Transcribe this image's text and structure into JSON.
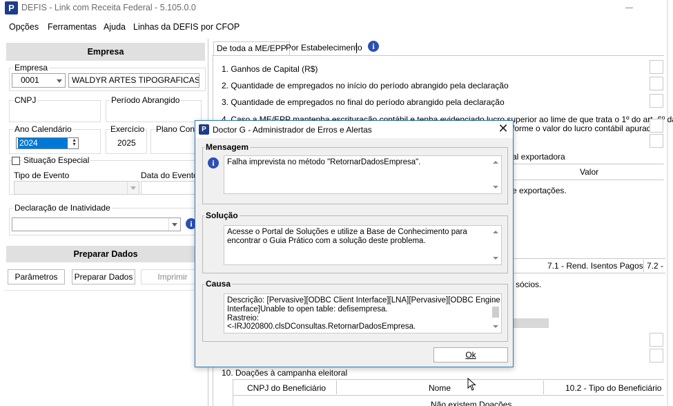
{
  "window": {
    "title": "DEFIS - Link com Receita Federal - 5.105.0.0",
    "icon_letter": "P"
  },
  "menu": [
    "Opções",
    "Ferramentas",
    "Ajuda",
    "Linhas da DEFIS por CFOP"
  ],
  "left": {
    "empresa_header": "Empresa",
    "empresa_label": "Empresa",
    "empresa_code": "0001",
    "empresa_name": "WALDYR ARTES TIPOGRAFICAS LTDA",
    "cnpj_label": "CNPJ",
    "periodo_label": "Período Abrangido",
    "ano_label": "Ano Calendário",
    "ano_value": "2024",
    "exercicio_label": "Exercício",
    "exercicio_value": "2025",
    "plano_label": "Plano Conta",
    "situacao_label": "Situação Especial",
    "tipo_evento_label": "Tipo de Evento",
    "data_evento_label": "Data do Evento",
    "declaracao_label": "Declaração de Inatividade",
    "preparar_header": "Preparar Dados",
    "btn_parametros": "Parâmetros",
    "btn_preparar": "Preparar Dados",
    "btn_imprimir": "Imprimir"
  },
  "right": {
    "tab1": "De toda a ME/EPP",
    "tab2": "Por Estabelecimento",
    "rows": [
      "1. Ganhos de Capital (R$)",
      "2. Quantidade de empregados no início do período abrangido pela declaração",
      "3. Quantidade de empregados no final do período abrangido pela declaração",
      "4. Caso a ME/EPP mantenha escrituração contábil e tenha evidenciado lucro superior ao lime de que trata o 1º do art. 6º da"
    ],
    "row4_cont": "forme o valor do lucro contábil apurado",
    "exportadora": "al exportadora",
    "valor_header": "Valor",
    "exportacoes": "e exportações.",
    "tab_isentos": "7.1 - Rend. Isentos Pagos",
    "tab_72": "7.2 -",
    "socios": "sócios.",
    "doacoes": "10. Doações à campanha eleitoral",
    "col_cnpj": "CNPJ do Beneficiário",
    "col_nome": "Nome",
    "col_tipo": "10.2 - Tipo do Beneficiário",
    "cut_text": "Não existem Doações"
  },
  "dialog": {
    "title": "Doctor G - Administrador de Erros e Alertas",
    "close": "✕",
    "mensagem_label": "Mensagem",
    "mensagem_text": "Falha imprevista no método \"RetornarDadosEmpresa\".",
    "solucao_label": "Solução",
    "solucao_text": "Acesse o Portal de Soluções e utilize a Base de Conhecimento para encontrar o Guia Prático com a solução deste problema.",
    "causa_label": "Causa",
    "causa_lines": [
      "Descrição: [Pervasive][ODBC Client Interface][LNA][Pervasive][ODBC Engine",
      "Interface]Unable to open table: defisempresa.",
      "Rastreio:",
      "<-IRJ020800.clsDConsultas.RetornarDadosEmpresa."
    ],
    "ok_label": "Ok"
  }
}
